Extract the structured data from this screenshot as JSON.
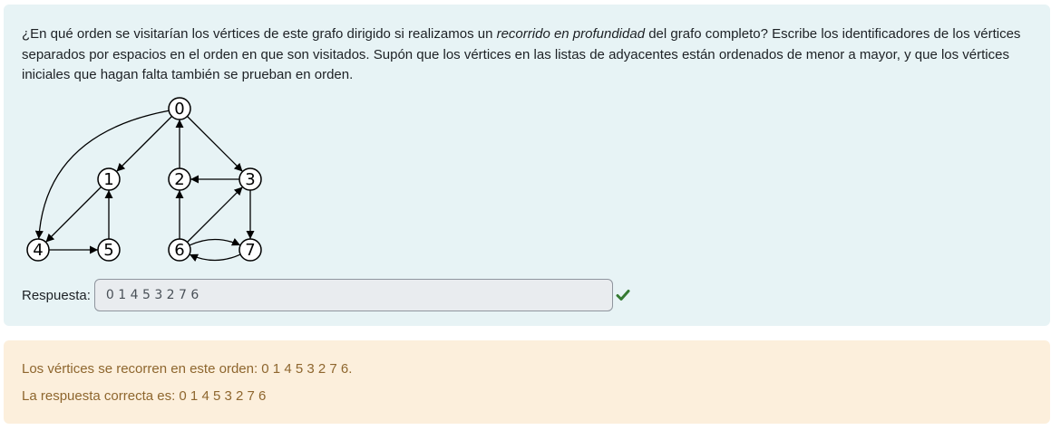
{
  "question": {
    "text_before": "¿En qué orden se visitarían los vértices de este grafo dirigido si realizamos un ",
    "text_emphasis": "recorrido en profundidad",
    "text_after": " del grafo completo? Escribe los identificadores de los vértices separados por espacios en el orden en que son visitados. Supón que los vértices en las listas de adyacentes están ordenados de menor a mayor, y que los vértices iniciales que hagan falta también se prueban en orden."
  },
  "graph": {
    "nodes": [
      {
        "id": "0"
      },
      {
        "id": "1"
      },
      {
        "id": "2"
      },
      {
        "id": "3"
      },
      {
        "id": "4"
      },
      {
        "id": "5"
      },
      {
        "id": "6"
      },
      {
        "id": "7"
      }
    ],
    "edges": [
      {
        "from": "0",
        "to": "1"
      },
      {
        "from": "0",
        "to": "3"
      },
      {
        "from": "0",
        "to": "4"
      },
      {
        "from": "2",
        "to": "0"
      },
      {
        "from": "1",
        "to": "4"
      },
      {
        "from": "4",
        "to": "5"
      },
      {
        "from": "5",
        "to": "1"
      },
      {
        "from": "3",
        "to": "2"
      },
      {
        "from": "3",
        "to": "7"
      },
      {
        "from": "6",
        "to": "2"
      },
      {
        "from": "6",
        "to": "3"
      },
      {
        "from": "6",
        "to": "7"
      },
      {
        "from": "7",
        "to": "6"
      }
    ]
  },
  "answer": {
    "label": "Respuesta:",
    "value": "0 1 4 5 3 2 7 6",
    "status_icon": "check-icon",
    "status_color": "#357a32"
  },
  "feedback": {
    "general": "Los vértices se recorren en este orden: 0 1 4 5 3 2 7 6.",
    "correct_answer": "La respuesta correcta es: 0 1 4 5 3 2 7 6"
  },
  "colors": {
    "question_bg": "#e7f3f5",
    "feedback_bg": "#fcefdc",
    "feedback_text": "#8e662e"
  }
}
